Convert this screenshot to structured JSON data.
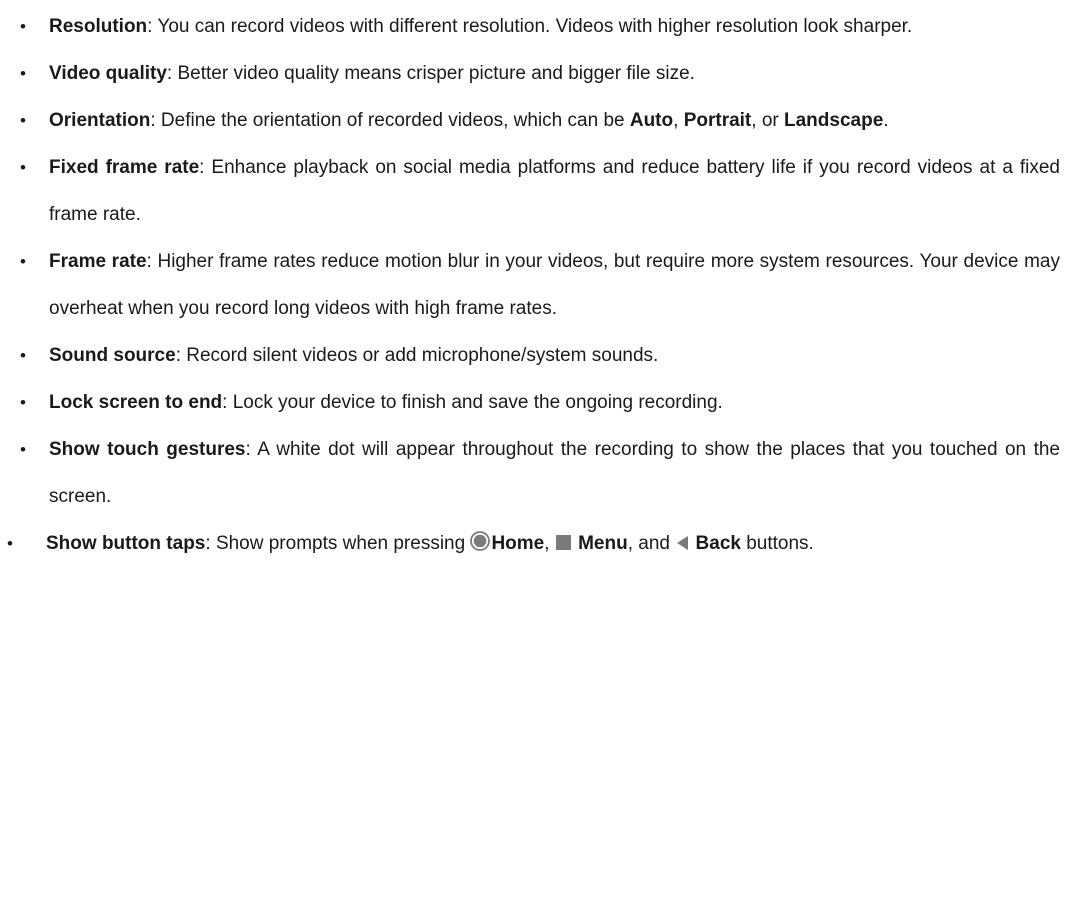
{
  "bullet_glyph": "•",
  "items": [
    {
      "term": "Resolution",
      "sep": ": ",
      "text": "You can record videos with different resolution. Videos with higher resolution look sharper."
    },
    {
      "term": "Video quality",
      "sep": ": ",
      "text": "Better video quality means crisper picture and bigger file size."
    },
    {
      "term": "Orientation",
      "sep": ": ",
      "text_before": "Define the orientation of recorded videos, which can be ",
      "option_auto": "Auto",
      "comma_1": ", ",
      "option_portrait": "Portrait",
      "or_text": ", or ",
      "option_landscape": "Landscape",
      "end": "."
    },
    {
      "term": "Fixed frame rate",
      "sep": ": ",
      "text": "Enhance playback on social media platforms and reduce battery life if you record videos at a fixed frame rate."
    },
    {
      "term": "Frame rate",
      "sep": ": ",
      "text": "Higher frame rates reduce motion blur in your videos, but require more system resources. Your device may overheat when you record long videos with high frame rates."
    },
    {
      "term": "Sound source",
      "sep": ": ",
      "text": "Record silent videos or add microphone/system sounds."
    },
    {
      "term": "Lock screen to end",
      "sep": ": ",
      "text": "Lock your device to finish and save the ongoing recording."
    },
    {
      "term": "Show touch gestures",
      "sep": ": ",
      "text": "A white dot will appear throughout the recording to show the places that you touched on the screen."
    },
    {
      "term": "Show button taps",
      "sep": ": ",
      "text_before": "Show prompts when pressing ",
      "home_icon": "home-circle-icon",
      "home_label": "Home",
      "comma_1": ", ",
      "menu_icon": "menu-square-icon",
      "menu_label": "Menu",
      "and_text": ", and ",
      "back_icon": "back-triangle-icon",
      "back_label": "Back",
      "end": " buttons."
    }
  ],
  "icon_color": "#7a7a7a"
}
